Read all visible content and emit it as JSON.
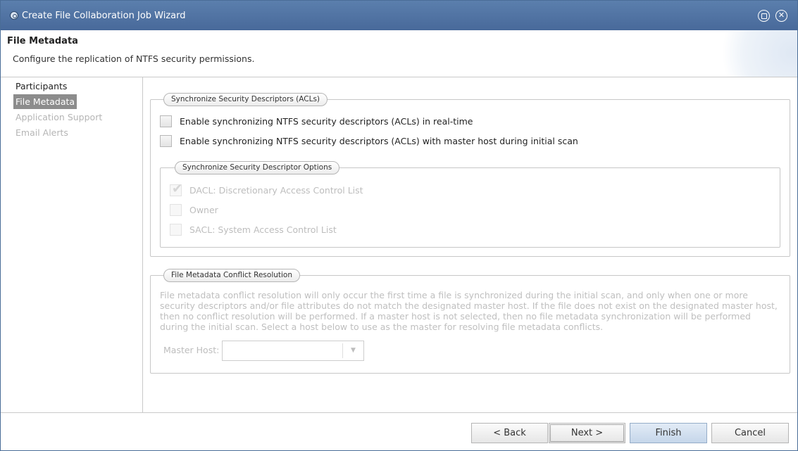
{
  "window": {
    "title": "Create File Collaboration Job Wizard"
  },
  "header": {
    "title": "File Metadata",
    "description": "Configure the replication of NTFS security permissions."
  },
  "sidebar": {
    "items": [
      {
        "label": "Participants",
        "state": "normal"
      },
      {
        "label": "File Metadata",
        "state": "active"
      },
      {
        "label": "Application Support",
        "state": "disabled"
      },
      {
        "label": "Email Alerts",
        "state": "disabled"
      }
    ]
  },
  "sync_group": {
    "legend": "Synchronize Security Descriptors (ACLs)",
    "realtime_label": "Enable synchronizing NTFS security descriptors (ACLs) in real-time",
    "realtime_checked": false,
    "initial_scan_label": "Enable synchronizing NTFS security descriptors (ACLs) with master host during initial scan",
    "initial_scan_checked": false,
    "options": {
      "legend": "Synchronize Security Descriptor Options",
      "dacl_label": "DACL: Discretionary Access Control List",
      "dacl_checked": true,
      "owner_label": "Owner",
      "owner_checked": false,
      "sacl_label": "SACL: System Access Control List",
      "sacl_checked": false
    }
  },
  "conflict_group": {
    "legend": "File Metadata Conflict Resolution",
    "description": "File metadata conflict resolution will only occur the first time a file is synchronized during the initial scan, and only when one or more security descriptors and/or file attributes do not match the designated master host. If the file does not exist on the designated master host, then no conflict resolution will be performed. If a master host is not selected, then no file metadata synchronization will be performed during the initial scan. Select a host below to use as the master for resolving file metadata conflicts.",
    "master_host_label": "Master Host:",
    "master_host_value": ""
  },
  "footer": {
    "back_label": "< Back",
    "next_label": "Next >",
    "finish_label": "Finish",
    "cancel_label": "Cancel"
  }
}
